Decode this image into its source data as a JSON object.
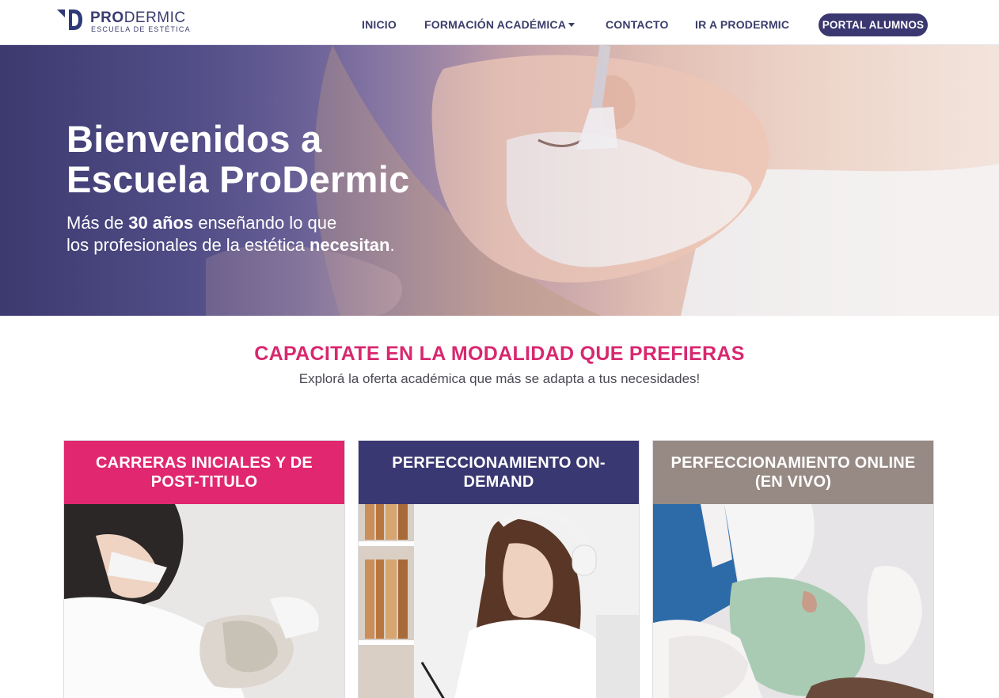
{
  "header": {
    "logo": {
      "brand_bold": "PRO",
      "brand_rest": "DERMIC",
      "tagline": "ESCUELA DE ESTÉTICA"
    },
    "nav": [
      {
        "label": "INICIO"
      },
      {
        "label": "FORMACIÓN ACADÉMICA",
        "has_dropdown": true
      },
      {
        "label": "CONTACTO"
      },
      {
        "label": "IR A PRODERMIC"
      }
    ],
    "portal_button": "PORTAL ALUMNOS"
  },
  "hero": {
    "title_line1": "Bienvenidos a",
    "title_line2": "Escuela ProDermic",
    "sub_line1_pre": "Más de ",
    "sub_line1_bold": "30 años",
    "sub_line1_post": " enseñando lo que",
    "sub_line2_pre": "los profesionales de la estética ",
    "sub_line2_bold": "necesitan",
    "sub_line2_post": "."
  },
  "section": {
    "title": "CAPACITATE EN LA MODALIDAD QUE PREFIERAS",
    "subtitle": "Explorá la oferta académica que más se adapta a tus necesidades!"
  },
  "cards": [
    {
      "title": "CARRERAS INICIALES Y DE POST-TITULO",
      "color": "#e0276f"
    },
    {
      "title": "PERFECCIONAMIENTO ON-DEMAND",
      "color": "#3a3872"
    },
    {
      "title": "PERFECCIONAMIENTO ONLINE (EN VIVO)",
      "color": "#978a84"
    }
  ],
  "colors": {
    "primary": "#3a3b6e",
    "accent": "#d8286f",
    "muted": "#978a84"
  }
}
